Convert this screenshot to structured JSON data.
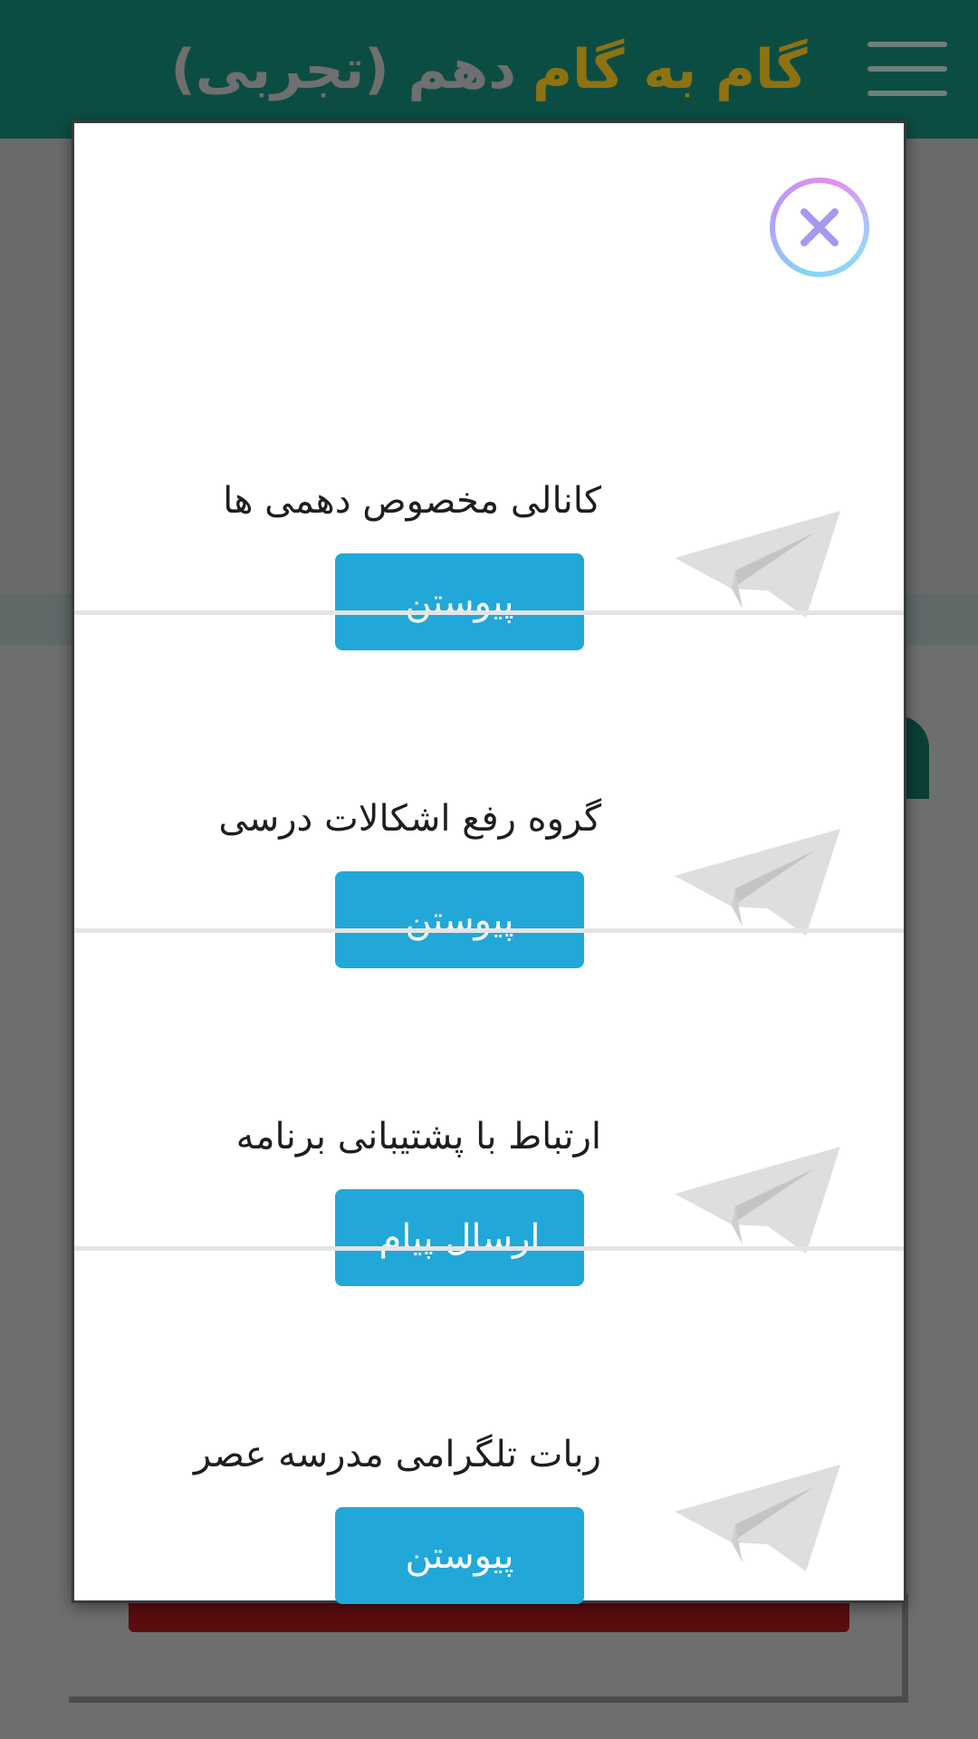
{
  "header": {
    "title_accent": "گام به گام",
    "title_rest": "دهم (تجربی)"
  },
  "modal": {
    "close_icon": "close-x-icon",
    "items": [
      {
        "label": "کانالی مخصوص دهمی ها",
        "button": "پیوستن",
        "icon": "telegram-plane-icon"
      },
      {
        "label": "گروه رفع اشکالات درسی",
        "button": "پیوستن",
        "icon": "telegram-plane-icon"
      },
      {
        "label": "ارتباط با پشتیبانی برنامه",
        "button": "ارسال پیام",
        "icon": "telegram-plane-icon"
      },
      {
        "label": "ربات تلگرامی مدرسه عصر",
        "button": "پیوستن",
        "icon": "telegram-plane-icon"
      }
    ]
  },
  "colors": {
    "header_bg": "#0c4d43",
    "title_accent": "#8e7212",
    "button_bg": "#21a8d8"
  }
}
